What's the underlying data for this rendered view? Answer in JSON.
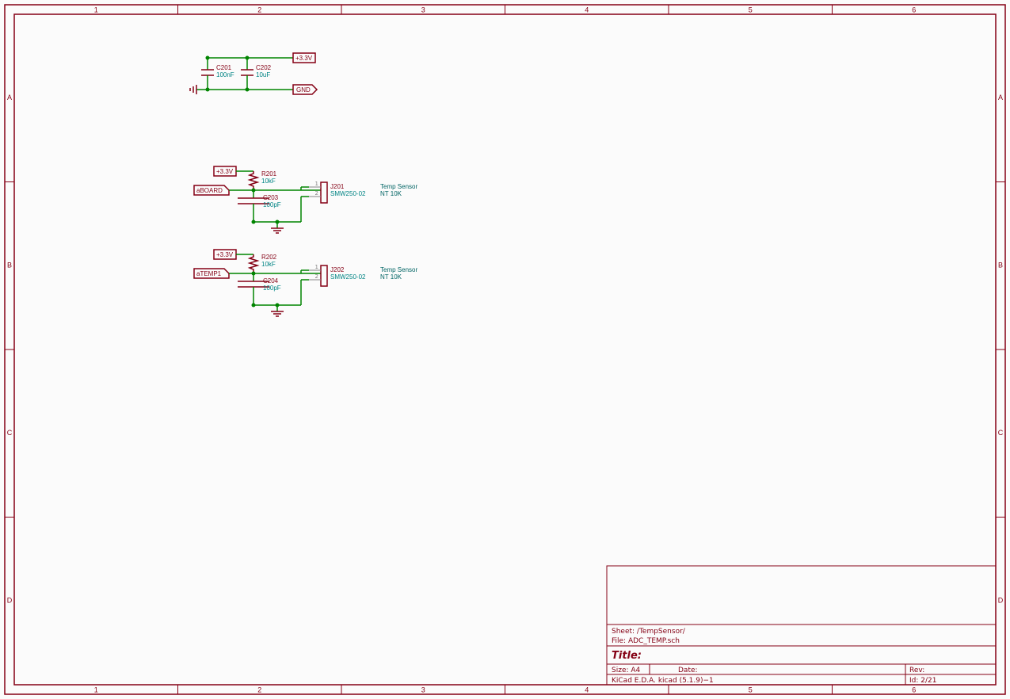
{
  "ruler": {
    "cols": [
      "1",
      "2",
      "3",
      "4",
      "5",
      "6"
    ],
    "rows": [
      "A",
      "B",
      "C",
      "D"
    ]
  },
  "power": {
    "p33v_top": "+3.3V",
    "gnd_top": "GND",
    "p33v_b1": "+3.3V",
    "p33v_b2": "+3.3V"
  },
  "nets": {
    "aboard": "aBOARD",
    "atemp1": "aTEMP1"
  },
  "caps": {
    "c201": {
      "ref": "C201",
      "val": "100nF"
    },
    "c202": {
      "ref": "C202",
      "val": "10uF"
    },
    "c203": {
      "ref": "C203",
      "val": "100pF"
    },
    "c204": {
      "ref": "C204",
      "val": "100pF"
    }
  },
  "res": {
    "r201": {
      "ref": "R201",
      "val": "10kF"
    },
    "r202": {
      "ref": "R202",
      "val": "10kF"
    }
  },
  "conn": {
    "j201": {
      "ref": "J201",
      "val": "SMW250-02",
      "note1": "Temp Sensor",
      "note2": "NT 10K",
      "p1": "1",
      "p2": "2"
    },
    "j202": {
      "ref": "J202",
      "val": "SMW250-02",
      "note1": "Temp Sensor",
      "note2": "NT 10K",
      "p1": "1",
      "p2": "2"
    }
  },
  "titleblock": {
    "sheet": "Sheet: /TempSensor/",
    "file": "File: ADC_TEMP.sch",
    "title_label": "Title:",
    "size": "Size: A4",
    "date": "Date:",
    "rev": "Rev:",
    "eda": "KiCad E.D.A.  kicad (5.1.9)−1",
    "id": "Id: 2/21"
  }
}
